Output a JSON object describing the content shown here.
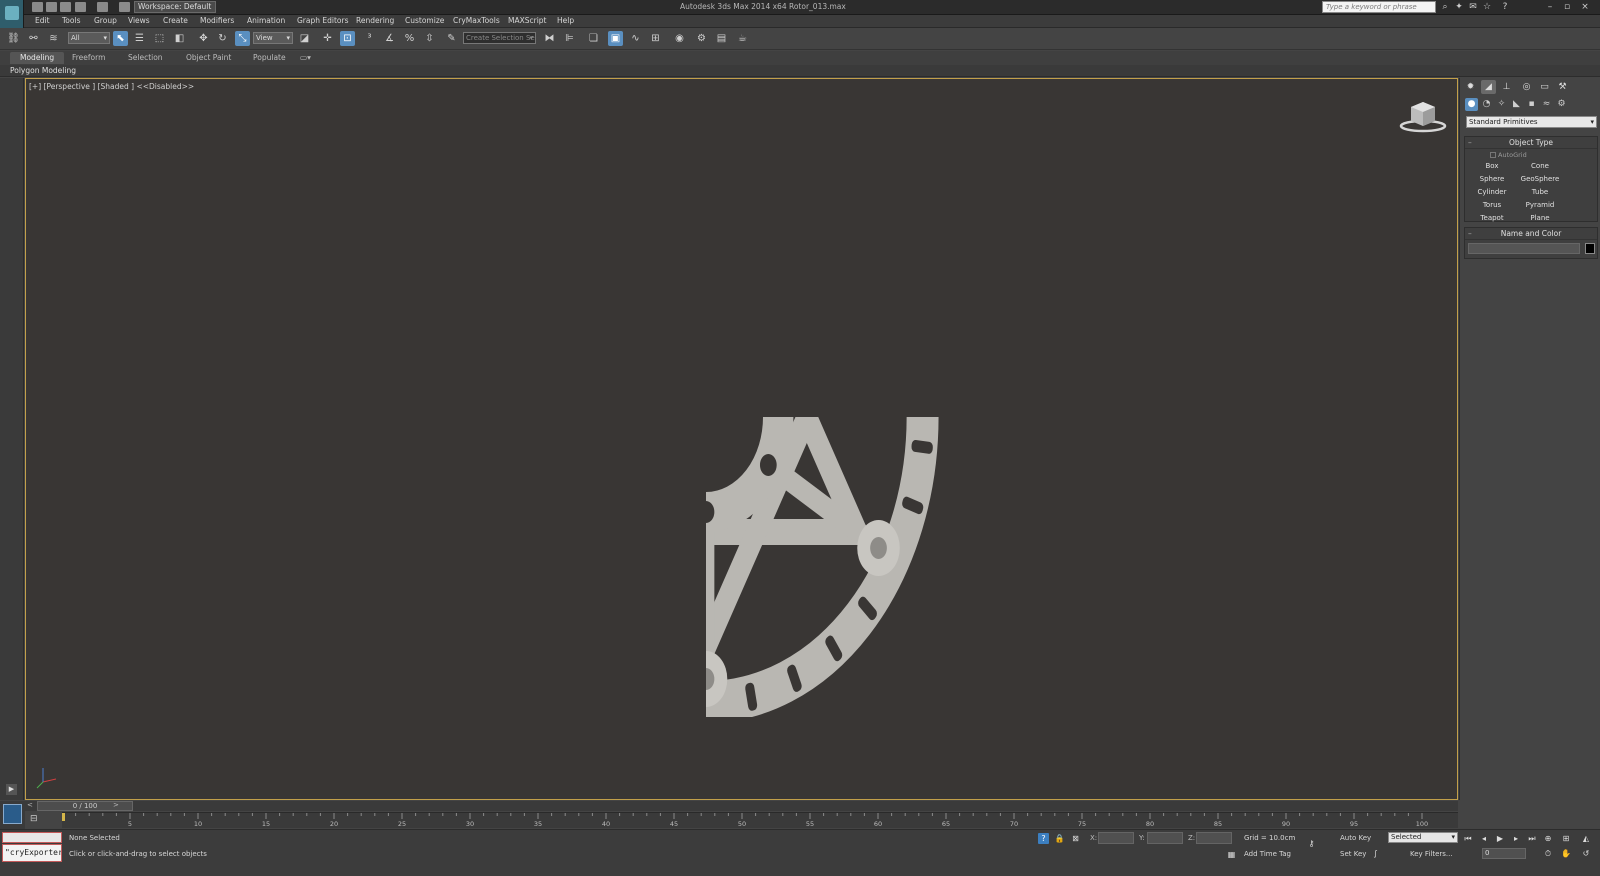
{
  "window": {
    "title": "Autodesk 3ds Max  2014 x64       Rotor_013.max",
    "workspace": "Workspace: Default",
    "search_placeholder": "Type a keyword or phrase"
  },
  "menu": [
    "Edit",
    "Tools",
    "Group",
    "Views",
    "Create",
    "Modifiers",
    "Animation",
    "Graph Editors",
    "Rendering",
    "Customize",
    "CryMaxTools",
    "MAXScript",
    "Help"
  ],
  "toolbar": {
    "filter_value": "All",
    "refcoord_value": "View",
    "named_selection_placeholder": "Create Selection Se"
  },
  "ribbon": {
    "tabs": [
      "Modeling",
      "Freeform",
      "Selection",
      "Object Paint",
      "Populate"
    ],
    "active_tab": "Modeling",
    "panel_label": "Polygon Modeling"
  },
  "viewport": {
    "label": "[+] [Perspective ] [Shaded ]  <<Disabled>>"
  },
  "command_panel": {
    "category": "Standard Primitives",
    "object_type": {
      "title": "Object Type",
      "autogrid": "AutoGrid",
      "buttons": [
        "Box",
        "Cone",
        "Sphere",
        "GeoSphere",
        "Cylinder",
        "Tube",
        "Torus",
        "Pyramid",
        "Teapot",
        "Plane"
      ]
    },
    "name_color": {
      "title": "Name and Color"
    }
  },
  "timeline": {
    "frame_display": "0 / 100",
    "ticks": [
      "5",
      "10",
      "15",
      "20",
      "25",
      "30",
      "35",
      "40",
      "45",
      "50",
      "55",
      "60",
      "65",
      "70",
      "75",
      "80",
      "85",
      "90",
      "95",
      "100"
    ]
  },
  "status": {
    "maxscript_value": "\"cryExporter.",
    "selection": "None Selected",
    "prompt": "Click or click-and-drag to select objects",
    "x_label": "X:",
    "y_label": "Y:",
    "z_label": "Z:",
    "grid": "Grid = 10.0cm",
    "add_time_tag": "Add Time Tag",
    "auto_key": "Auto Key",
    "set_key": "Set Key",
    "selected_value": "Selected",
    "key_filters": "Key Filters...",
    "frame_value": "0"
  },
  "colors": {
    "viewport_bg": "#393634",
    "viewport_border": "#c2a04a",
    "rotor_fill": "#b9b7b2",
    "active_blue": "#5a8fc0"
  }
}
